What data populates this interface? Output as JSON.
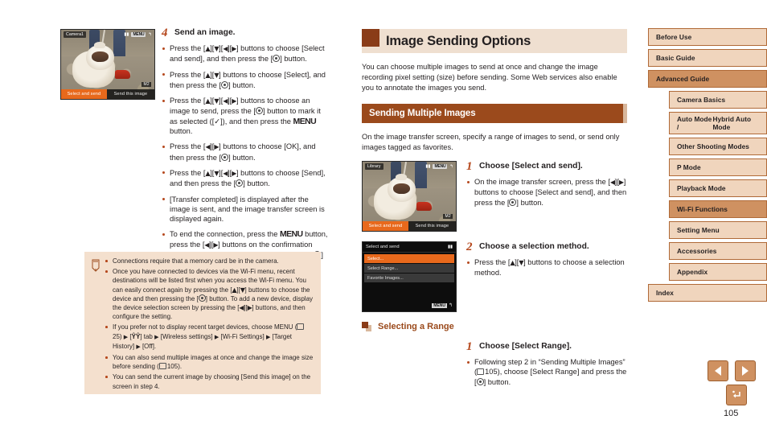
{
  "document": {
    "page_number": "105"
  },
  "left_column": {
    "step": {
      "number": "4",
      "title": "Send an image.",
      "bullets": [
        {
          "parts": [
            {
              "t": "text",
              "v": "Press the ["
            },
            {
              "t": "key",
              "v": "up"
            },
            {
              "t": "text",
              "v": "]["
            },
            {
              "t": "key",
              "v": "down"
            },
            {
              "t": "text",
              "v": "]["
            },
            {
              "t": "key",
              "v": "left"
            },
            {
              "t": "text",
              "v": "]["
            },
            {
              "t": "key",
              "v": "right"
            },
            {
              "t": "text",
              "v": "] buttons to choose [Select and send], and then press the ["
            },
            {
              "t": "func",
              "v": "func-set"
            },
            {
              "t": "text",
              "v": "] button."
            }
          ]
        },
        {
          "parts": [
            {
              "t": "text",
              "v": "Press the ["
            },
            {
              "t": "key",
              "v": "up"
            },
            {
              "t": "text",
              "v": "]["
            },
            {
              "t": "key",
              "v": "down"
            },
            {
              "t": "text",
              "v": "] buttons to choose [Select], and then press the ["
            },
            {
              "t": "func",
              "v": "func-set"
            },
            {
              "t": "text",
              "v": "] button."
            }
          ]
        },
        {
          "parts": [
            {
              "t": "text",
              "v": "Press the ["
            },
            {
              "t": "key",
              "v": "up"
            },
            {
              "t": "text",
              "v": "]["
            },
            {
              "t": "key",
              "v": "down"
            },
            {
              "t": "text",
              "v": "]["
            },
            {
              "t": "key",
              "v": "left"
            },
            {
              "t": "text",
              "v": "]["
            },
            {
              "t": "key",
              "v": "right"
            },
            {
              "t": "text",
              "v": "] buttons to choose an image to send, press the ["
            },
            {
              "t": "func",
              "v": "func-set"
            },
            {
              "t": "text",
              "v": "] button to mark it as selected (["
            },
            {
              "t": "check",
              "v": "✓"
            },
            {
              "t": "text",
              "v": "]), and then press the "
            },
            {
              "t": "menu",
              "v": "MENU"
            },
            {
              "t": "text",
              "v": " button."
            }
          ]
        },
        {
          "parts": [
            {
              "t": "text",
              "v": "Press the ["
            },
            {
              "t": "key",
              "v": "left"
            },
            {
              "t": "text",
              "v": "]["
            },
            {
              "t": "key",
              "v": "right"
            },
            {
              "t": "text",
              "v": "] buttons to choose [OK], and then press the ["
            },
            {
              "t": "func",
              "v": "func-set"
            },
            {
              "t": "text",
              "v": "] button."
            }
          ]
        },
        {
          "parts": [
            {
              "t": "text",
              "v": "Press the ["
            },
            {
              "t": "key",
              "v": "up"
            },
            {
              "t": "text",
              "v": "]["
            },
            {
              "t": "key",
              "v": "down"
            },
            {
              "t": "text",
              "v": "]["
            },
            {
              "t": "key",
              "v": "left"
            },
            {
              "t": "text",
              "v": "]["
            },
            {
              "t": "key",
              "v": "right"
            },
            {
              "t": "text",
              "v": "] buttons to choose [Send], and then press the ["
            },
            {
              "t": "func",
              "v": "func-set"
            },
            {
              "t": "text",
              "v": "] button."
            }
          ]
        },
        {
          "parts": [
            {
              "t": "text",
              "v": "[Transfer completed] is displayed after the image is sent, and the image transfer screen is displayed again."
            }
          ]
        },
        {
          "parts": [
            {
              "t": "text",
              "v": "To end the connection, press the "
            },
            {
              "t": "menu",
              "v": "MENU"
            },
            {
              "t": "text",
              "v": " button, press the ["
            },
            {
              "t": "key",
              "v": "left"
            },
            {
              "t": "text",
              "v": "]["
            },
            {
              "t": "key",
              "v": "right"
            },
            {
              "t": "text",
              "v": "] buttons on the confirmation screen to choose [OK], and then press the ["
            },
            {
              "t": "func",
              "v": "func-set"
            },
            {
              "t": "text",
              "v": "] button."
            }
          ]
        }
      ]
    },
    "camera_screen": {
      "top_label": "Camera1",
      "menu_chip": "MENU",
      "info_chip": "M2",
      "button_selected": "Select and send",
      "button_other": "Send this image"
    },
    "note": {
      "icon": "pencil-icon",
      "items": [
        {
          "parts": [
            {
              "t": "text",
              "v": "Connections require that a memory card be in the camera."
            }
          ]
        },
        {
          "parts": [
            {
              "t": "text",
              "v": "Once you have connected to devices via the Wi-Fi menu, recent destinations will be listed first when you access the Wi-Fi menu. You can easily connect again by pressing the ["
            },
            {
              "t": "key",
              "v": "up"
            },
            {
              "t": "text",
              "v": "]["
            },
            {
              "t": "key",
              "v": "down"
            },
            {
              "t": "text",
              "v": "] buttons to choose the device and then pressing the ["
            },
            {
              "t": "func",
              "v": "func-set"
            },
            {
              "t": "text",
              "v": "] button. To add a new device, display the device selection screen by pressing the ["
            },
            {
              "t": "key",
              "v": "left"
            },
            {
              "t": "text",
              "v": "]["
            },
            {
              "t": "key",
              "v": "right"
            },
            {
              "t": "text",
              "v": "] buttons, and then configure the setting."
            }
          ]
        },
        {
          "parts": [
            {
              "t": "text",
              "v": "If you prefer not to display recent target devices, choose MENU ("
            },
            {
              "t": "book",
              "v": "25"
            },
            {
              "t": "text",
              "v": ") "
            },
            {
              "t": "arrow",
              "v": "▶"
            },
            {
              "t": "text",
              "v": " ["
            },
            {
              "t": "wrench",
              "v": "tools"
            },
            {
              "t": "text",
              "v": "] tab "
            },
            {
              "t": "arrow",
              "v": "▶"
            },
            {
              "t": "text",
              "v": " [Wireless settings] "
            },
            {
              "t": "arrow",
              "v": "▶"
            },
            {
              "t": "text",
              "v": " [Wi-Fi Settings] "
            },
            {
              "t": "arrow",
              "v": "▶"
            },
            {
              "t": "text",
              "v": " [Target History] "
            },
            {
              "t": "arrow",
              "v": "▶"
            },
            {
              "t": "text",
              "v": " [Off]."
            }
          ]
        },
        {
          "parts": [
            {
              "t": "text",
              "v": "You can also send multiple images at once and change the image size before sending ("
            },
            {
              "t": "book",
              "v": "105"
            },
            {
              "t": "text",
              "v": ")."
            }
          ]
        },
        {
          "parts": [
            {
              "t": "text",
              "v": "You can send the current image by choosing [Send this image] on the screen in step 4."
            }
          ]
        }
      ]
    }
  },
  "main": {
    "title": "Image Sending Options",
    "intro": "You can choose multiple images to send at once and change the image recording pixel setting (size) before sending. Some Web services also enable you to annotate the images you send.",
    "section_heading": "Sending Multiple Images",
    "section_lead": "On the image transfer screen, specify a range of images to send, or send only images tagged as favorites.",
    "step1": {
      "number": "1",
      "title": "Choose [Select and send].",
      "bullets": [
        {
          "parts": [
            {
              "t": "text",
              "v": "On the image transfer screen, press the ["
            },
            {
              "t": "key",
              "v": "left"
            },
            {
              "t": "text",
              "v": "]["
            },
            {
              "t": "key",
              "v": "right"
            },
            {
              "t": "text",
              "v": "] buttons to choose [Select and send], and then press the ["
            },
            {
              "t": "func",
              "v": "func-set"
            },
            {
              "t": "text",
              "v": "] button."
            }
          ]
        }
      ],
      "screen": {
        "top_label": "Library",
        "menu_chip": "MENU",
        "info_chip": "M2",
        "button_selected": "Select and send",
        "button_other": "Send this image"
      }
    },
    "step2": {
      "number": "2",
      "title": "Choose a selection method.",
      "bullets": [
        {
          "parts": [
            {
              "t": "text",
              "v": "Press the ["
            },
            {
              "t": "key",
              "v": "up"
            },
            {
              "t": "text",
              "v": "]["
            },
            {
              "t": "key",
              "v": "down"
            },
            {
              "t": "text",
              "v": "] buttons to choose a selection method."
            }
          ]
        }
      ],
      "screen": {
        "title": "Select and send",
        "rows": [
          "Select...",
          "Select Range...",
          "Favorite Images..."
        ],
        "selected_index": 0,
        "back_chip": "MENU"
      }
    },
    "subsection_heading": "Selecting a Range",
    "step3": {
      "number": "1",
      "title": "Choose [Select Range].",
      "bullets": [
        {
          "parts": [
            {
              "t": "text",
              "v": "Following step 2 in “Sending Multiple Images” ("
            },
            {
              "t": "book",
              "v": "105"
            },
            {
              "t": "text",
              "v": "), choose [Select Range] and press the ["
            },
            {
              "t": "func",
              "v": "func-set"
            },
            {
              "t": "text",
              "v": "] button."
            }
          ]
        }
      ]
    }
  },
  "sidebar": {
    "items": [
      {
        "label": "Before Use",
        "level": 1,
        "active": false
      },
      {
        "label": "Basic Guide",
        "level": 1,
        "active": false
      },
      {
        "label": "Advanced Guide",
        "level": 1,
        "active": true
      },
      {
        "label": "Camera Basics",
        "level": 2,
        "active": false
      },
      {
        "label": "Auto Mode /\nHybrid Auto Mode",
        "level": 2,
        "active": false,
        "two_line": true
      },
      {
        "label": "Other Shooting Modes",
        "level": 2,
        "active": false
      },
      {
        "label": "P Mode",
        "level": 2,
        "active": false
      },
      {
        "label": "Playback Mode",
        "level": 2,
        "active": false
      },
      {
        "label": "Wi-Fi Functions",
        "level": 2,
        "active": true
      },
      {
        "label": "Setting Menu",
        "level": 2,
        "active": false
      },
      {
        "label": "Accessories",
        "level": 2,
        "active": false
      },
      {
        "label": "Appendix",
        "level": 2,
        "active": false
      },
      {
        "label": "Index",
        "level": 1,
        "active": false
      }
    ]
  },
  "pager": {
    "prev_icon": "triangle-left-icon",
    "next_icon": "triangle-right-icon",
    "home_icon": "return-home-icon"
  },
  "colors": {
    "accent_dark_brown": "#8a3c18",
    "accent_brown": "#9b4a1c",
    "nav_fill": "#f0d5bd",
    "nav_active": "#cf9161",
    "nav_border": "#b06a38",
    "note_bg": "#f4e0ce",
    "header_bg": "#efdfd0",
    "bullet": "#b5481d",
    "camera_highlight": "#e8691c"
  }
}
